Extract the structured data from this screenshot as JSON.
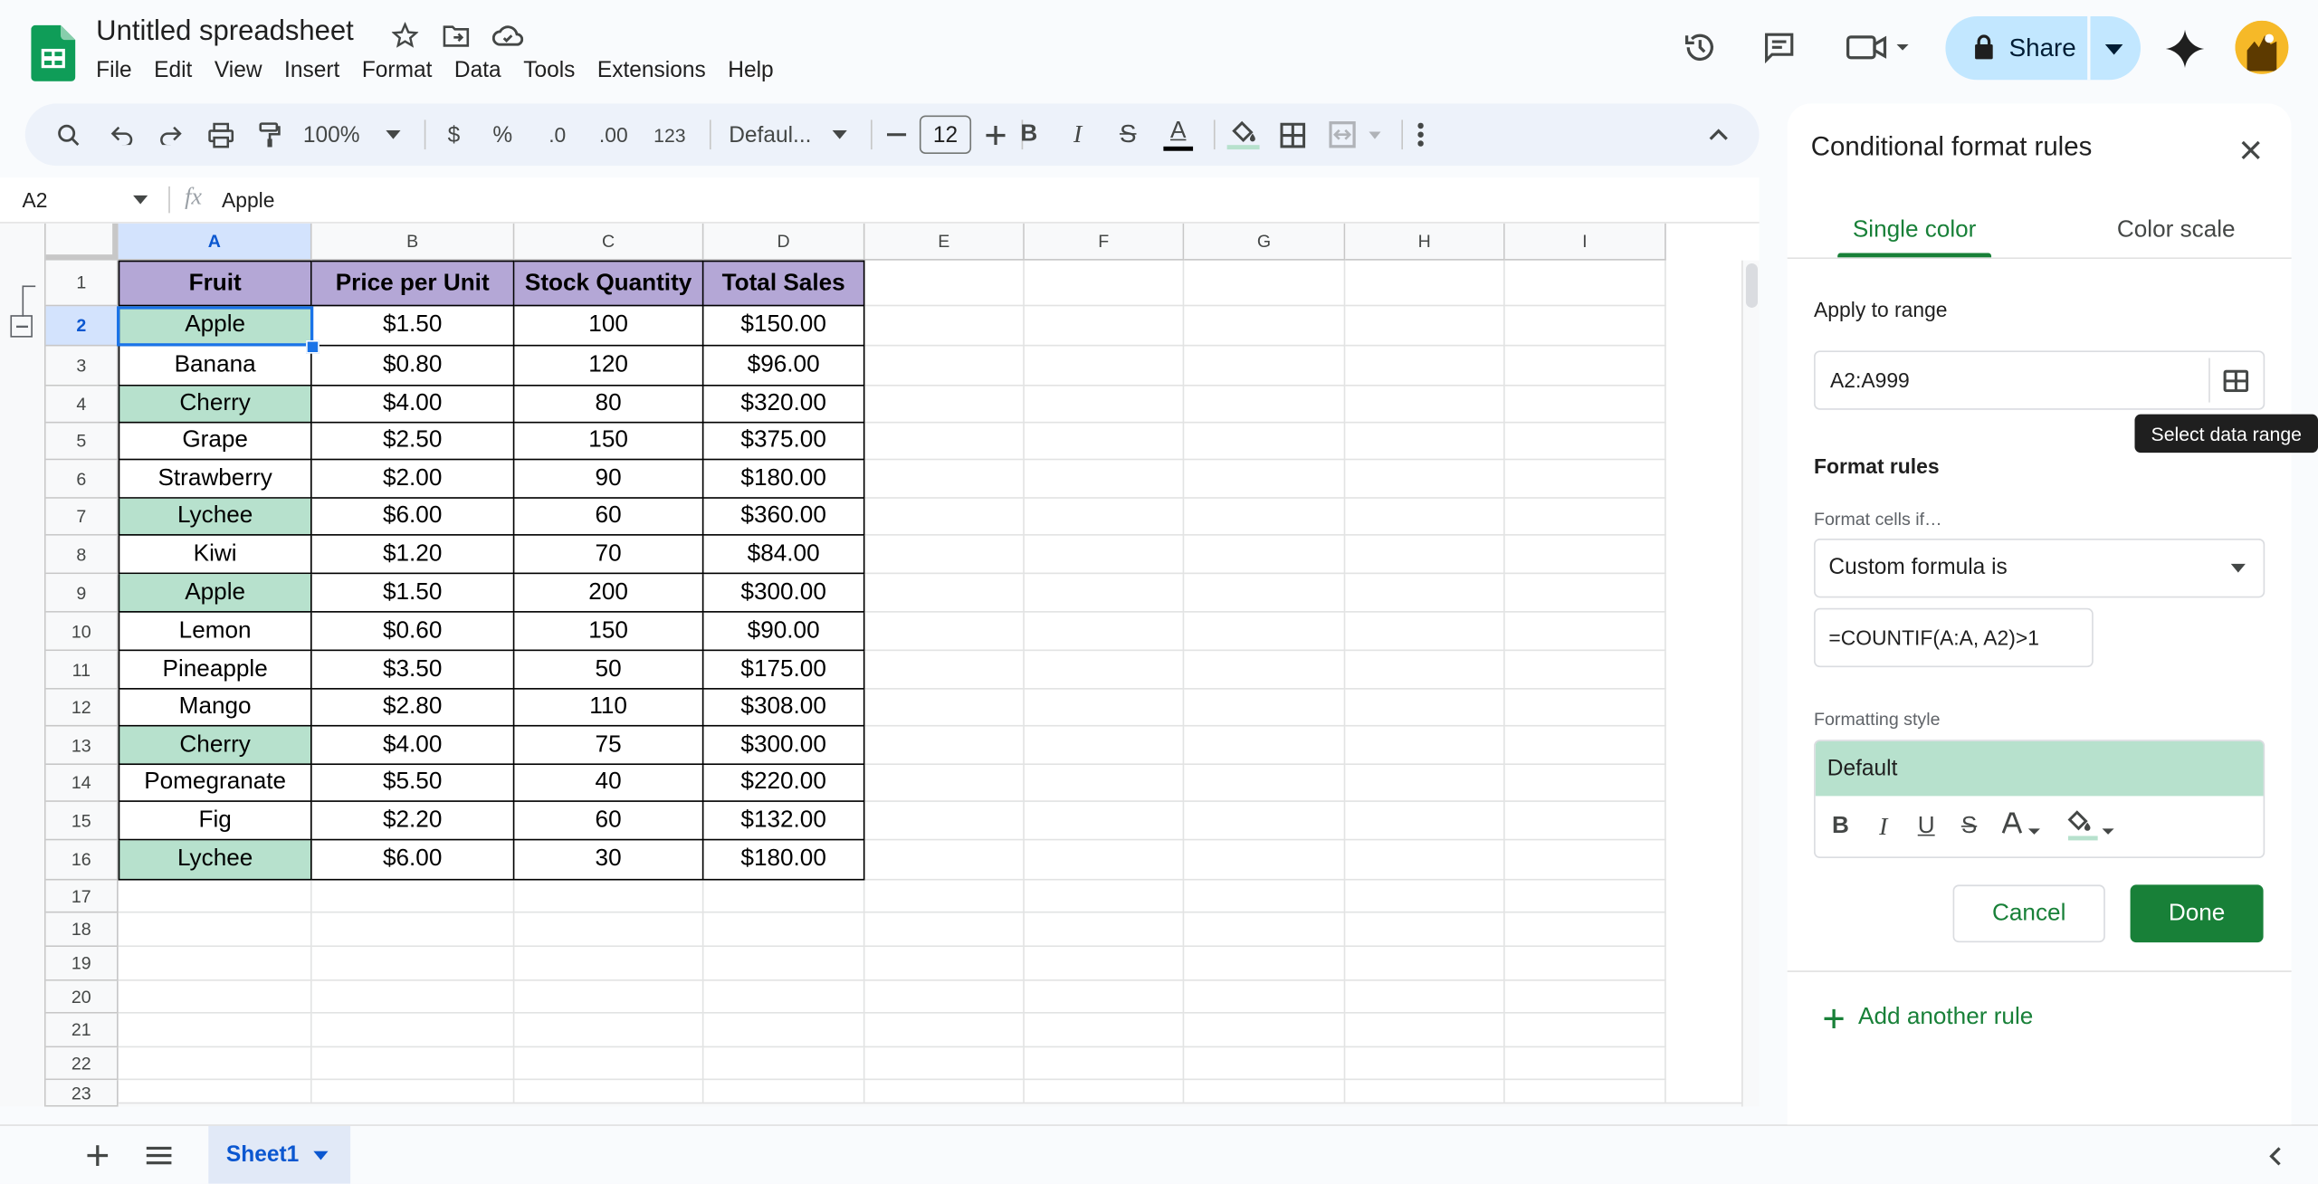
{
  "app": {
    "doc_title": "Untitled spreadsheet",
    "menu": [
      "File",
      "Edit",
      "View",
      "Insert",
      "Format",
      "Data",
      "Tools",
      "Extensions",
      "Help"
    ],
    "share_label": "Share",
    "brand_color": "#0f9d58"
  },
  "toolbar": {
    "zoom": "100%",
    "currency": "$",
    "percent": "%",
    "dec_decrease": ".0",
    "dec_increase": ".00",
    "number_format": "123",
    "font": "Defaul...",
    "font_size": "12",
    "bold": "B",
    "italic": "I",
    "strike": "S",
    "text_color": "A"
  },
  "formula_bar": {
    "name_box": "A2",
    "fx": "fx",
    "value": "Apple"
  },
  "grid": {
    "columns": [
      "A",
      "B",
      "C",
      "D",
      "E",
      "F",
      "G",
      "H",
      "I"
    ],
    "row_numbers": [
      "1",
      "2",
      "3",
      "4",
      "5",
      "6",
      "7",
      "8",
      "9",
      "10",
      "11",
      "12",
      "13",
      "14",
      "15",
      "16",
      "17",
      "18",
      "19",
      "20",
      "21",
      "22",
      "23"
    ],
    "header": [
      "Fruit",
      "Price per Unit",
      "Stock Quantity",
      "Total Sales"
    ],
    "rows": [
      [
        "Apple",
        "$1.50",
        "100",
        "$150.00"
      ],
      [
        "Banana",
        "$0.80",
        "120",
        "$96.00"
      ],
      [
        "Cherry",
        "$4.00",
        "80",
        "$320.00"
      ],
      [
        "Grape",
        "$2.50",
        "150",
        "$375.00"
      ],
      [
        "Strawberry",
        "$2.00",
        "90",
        "$180.00"
      ],
      [
        "Lychee",
        "$6.00",
        "60",
        "$360.00"
      ],
      [
        "Kiwi",
        "$1.20",
        "70",
        "$84.00"
      ],
      [
        "Apple",
        "$1.50",
        "200",
        "$300.00"
      ],
      [
        "Lemon",
        "$0.60",
        "150",
        "$90.00"
      ],
      [
        "Pineapple",
        "$3.50",
        "50",
        "$175.00"
      ],
      [
        "Mango",
        "$2.80",
        "110",
        "$308.00"
      ],
      [
        "Cherry",
        "$4.00",
        "75",
        "$300.00"
      ],
      [
        "Pomegranate",
        "$5.50",
        "40",
        "$220.00"
      ],
      [
        "Fig",
        "$2.20",
        "60",
        "$132.00"
      ],
      [
        "Lychee",
        "$6.00",
        "30",
        "$180.00"
      ]
    ],
    "highlighted_rows": [
      0,
      2,
      5,
      7,
      11,
      14
    ],
    "header_fill": "#b4a7d6",
    "highlight_fill": "#b7e1cd",
    "selected_cell": "A2"
  },
  "sheet_tabs": {
    "active": "Sheet1"
  },
  "panel": {
    "title": "Conditional format rules",
    "tabs": [
      "Single color",
      "Color scale"
    ],
    "active_tab": "Single color",
    "apply_label": "Apply to range",
    "range_value": "A2:A999",
    "tooltip": "Select data range",
    "format_rules_label": "Format rules",
    "condition_label": "Format cells if…",
    "condition_value": "Custom formula is",
    "formula_value": "=COUNTIF(A:A, A2)>1",
    "style_label": "Formatting style",
    "style_preview": "Default",
    "cancel_label": "Cancel",
    "done_label": "Done",
    "add_rule_label": "Add another rule",
    "accent_color": "#188038"
  }
}
